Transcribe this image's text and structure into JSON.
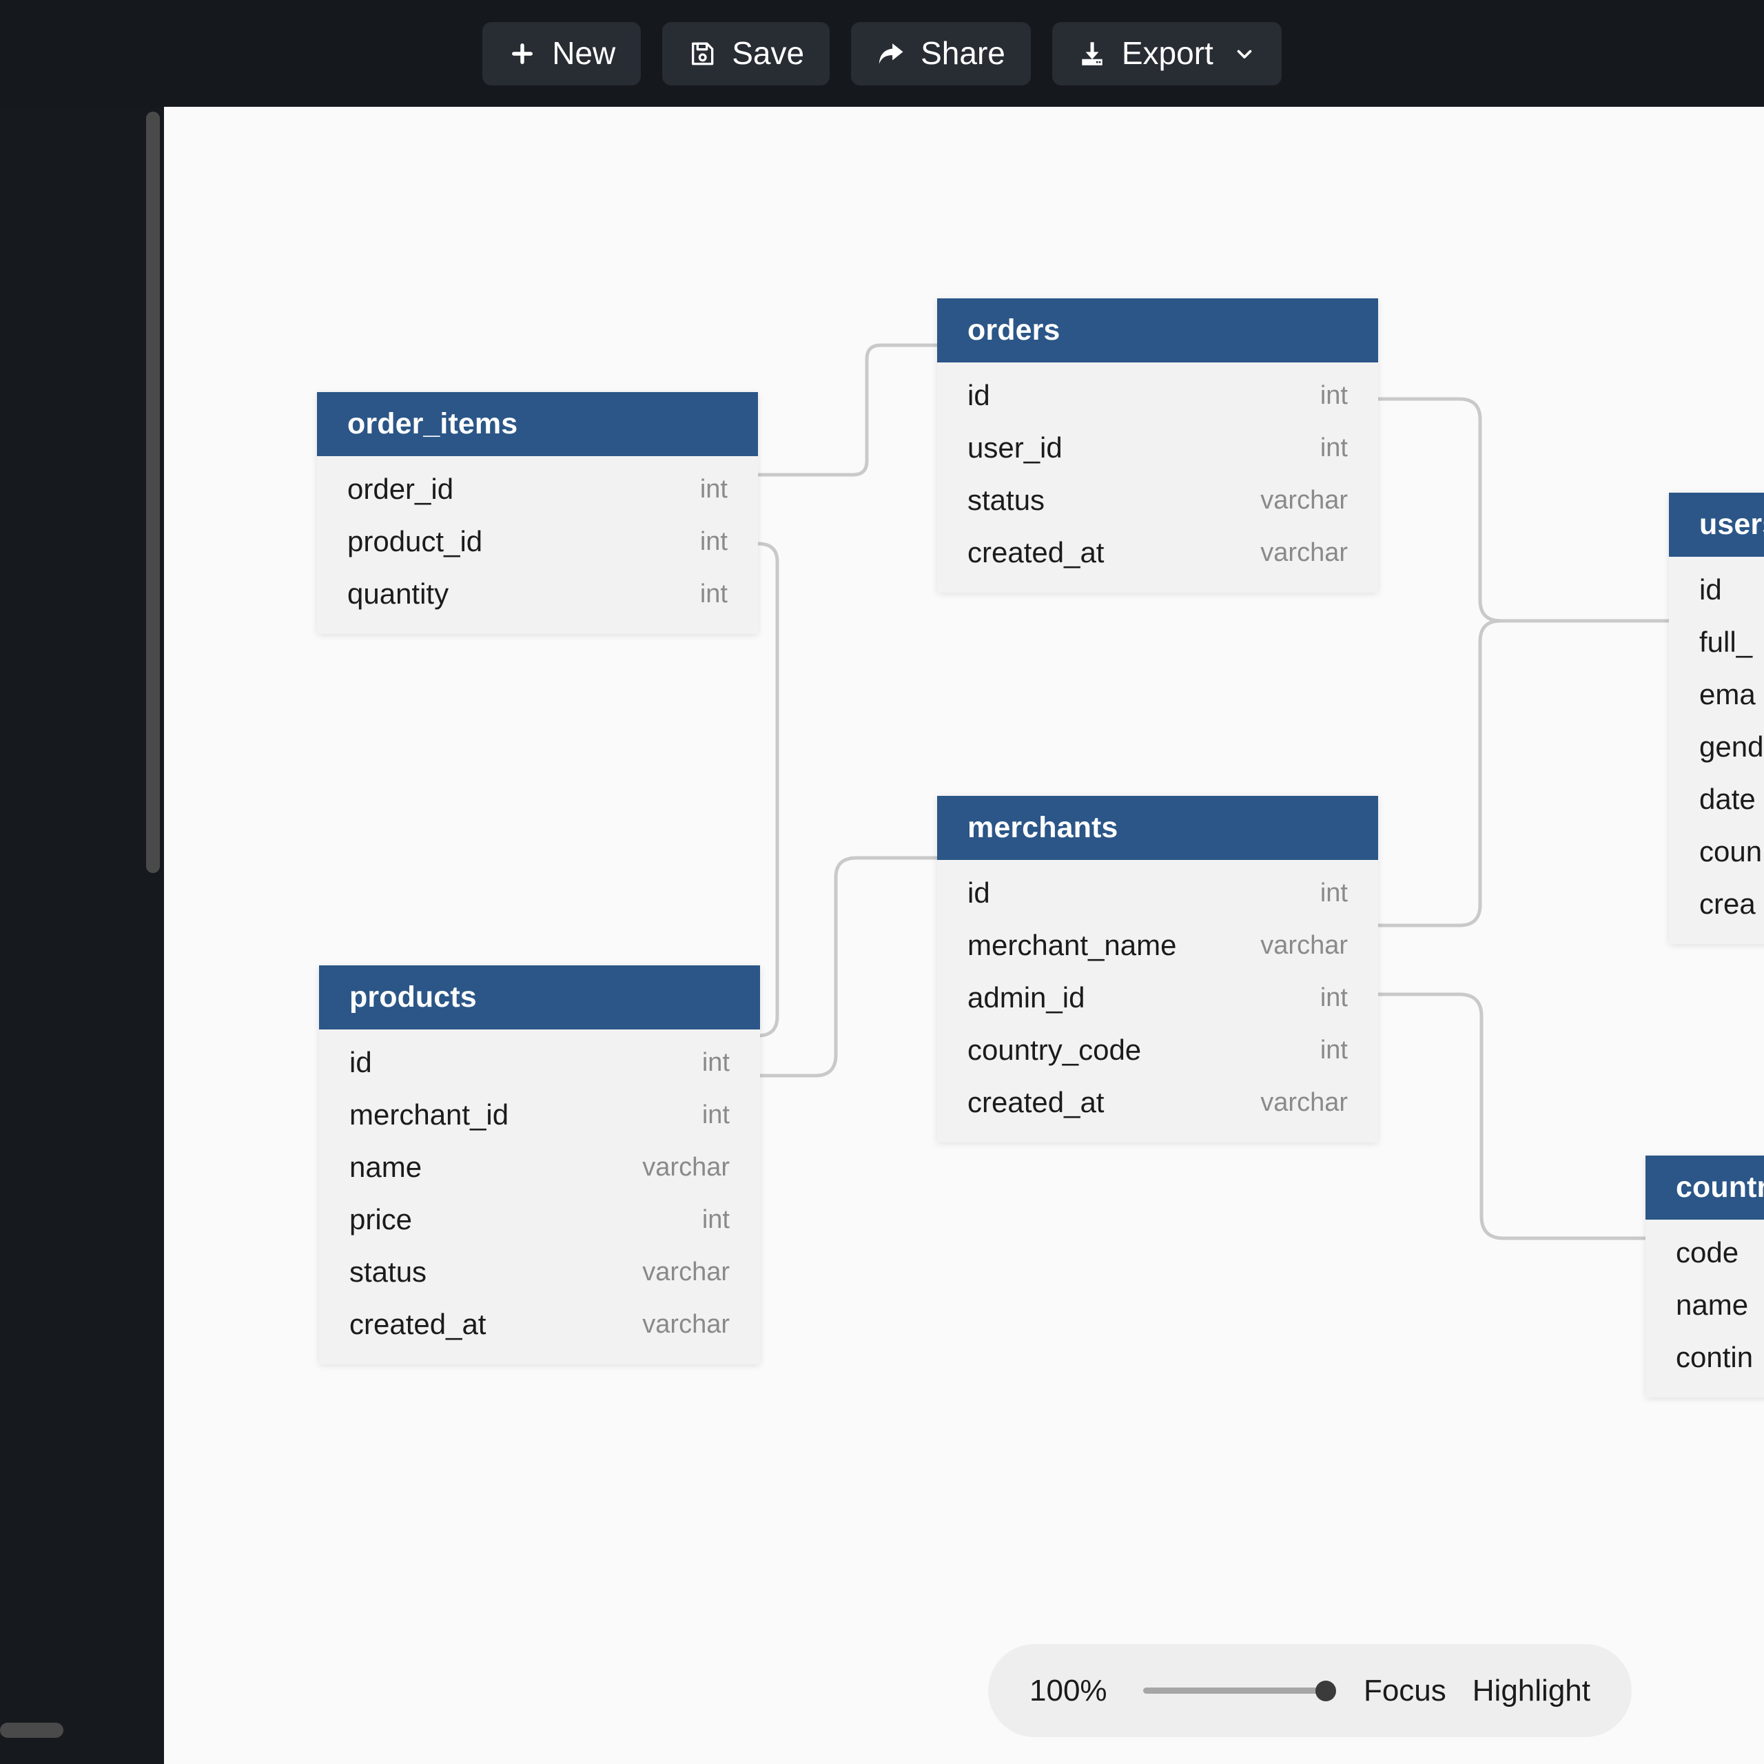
{
  "toolbar": {
    "buttons": [
      {
        "id": "new",
        "label": "New",
        "icon": "plus-icon"
      },
      {
        "id": "save",
        "label": "Save",
        "icon": "floppy-disk-icon"
      },
      {
        "id": "share",
        "label": "Share",
        "icon": "share-arrow-icon"
      },
      {
        "id": "export",
        "label": "Export",
        "icon": "download-tray-icon",
        "chevron": "chevron-down-icon"
      }
    ]
  },
  "canvas": {
    "background_color": "#fafafa",
    "header_color": "#2b5687",
    "body_color": "#f2f2f2",
    "connector_color": "#c9c9c9",
    "tables": [
      {
        "name": "order_items",
        "fields": [
          {
            "name": "order_id",
            "type": "int"
          },
          {
            "name": "product_id",
            "type": "int"
          },
          {
            "name": "quantity",
            "type": "int"
          }
        ]
      },
      {
        "name": "orders",
        "fields": [
          {
            "name": "id",
            "type": "int"
          },
          {
            "name": "user_id",
            "type": "int"
          },
          {
            "name": "status",
            "type": "varchar"
          },
          {
            "name": "created_at",
            "type": "varchar"
          }
        ]
      },
      {
        "name": "merchants",
        "fields": [
          {
            "name": "id",
            "type": "int"
          },
          {
            "name": "merchant_name",
            "type": "varchar"
          },
          {
            "name": "admin_id",
            "type": "int"
          },
          {
            "name": "country_code",
            "type": "int"
          },
          {
            "name": "created_at",
            "type": "varchar"
          }
        ]
      },
      {
        "name": "products",
        "fields": [
          {
            "name": "id",
            "type": "int"
          },
          {
            "name": "merchant_id",
            "type": "int"
          },
          {
            "name": "name",
            "type": "varchar"
          },
          {
            "name": "price",
            "type": "int"
          },
          {
            "name": "status",
            "type": "varchar"
          },
          {
            "name": "created_at",
            "type": "varchar"
          }
        ]
      },
      {
        "name": "users",
        "fields": [
          {
            "name": "id",
            "type": ""
          },
          {
            "name": "full_",
            "type": ""
          },
          {
            "name": "ema",
            "type": ""
          },
          {
            "name": "gend",
            "type": ""
          },
          {
            "name": "date",
            "type": ""
          },
          {
            "name": "coun",
            "type": ""
          },
          {
            "name": "crea",
            "type": ""
          }
        ]
      },
      {
        "name": "countri",
        "fields": [
          {
            "name": "code",
            "type": ""
          },
          {
            "name": "name",
            "type": ""
          },
          {
            "name": "contin",
            "type": ""
          }
        ]
      }
    ]
  },
  "zoombar": {
    "zoom_level": "100%",
    "slider_value": 100,
    "focus_label": "Focus",
    "highlight_label": "Highlight"
  }
}
